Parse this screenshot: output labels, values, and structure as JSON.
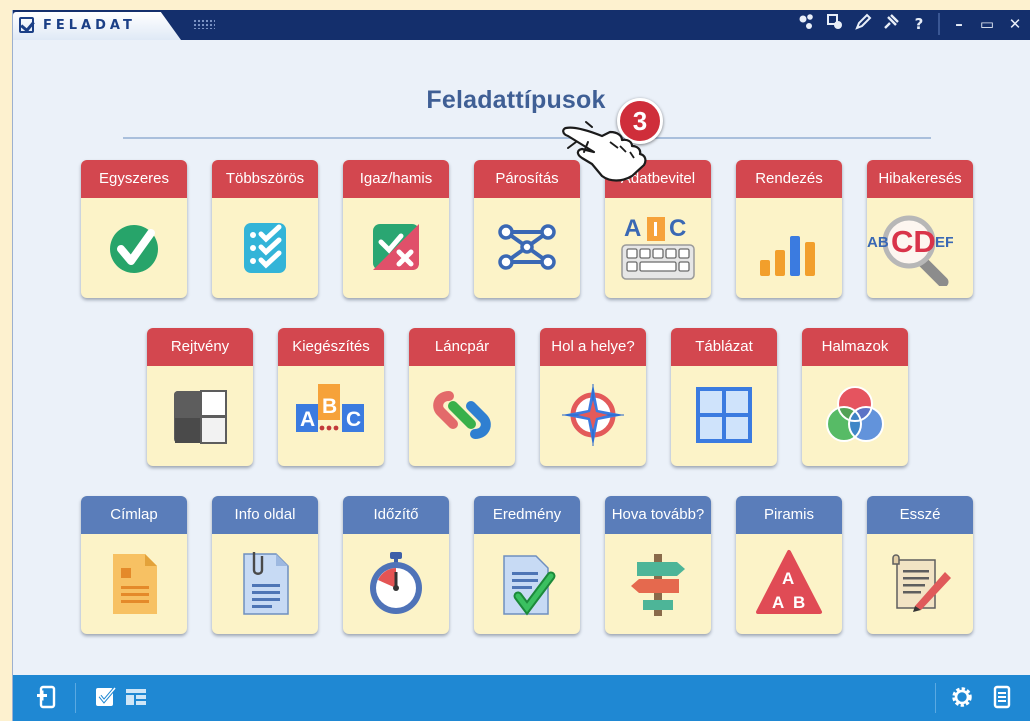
{
  "window": {
    "title": "FELADAT"
  },
  "titlebar_icons": [
    "share-icon",
    "people-swap-icon",
    "pencil-icon",
    "pin-icon",
    "help-icon",
    "minimize-icon",
    "maximize-icon",
    "close-icon"
  ],
  "titlebar_glyphs": [
    "",
    "",
    "",
    "",
    "?",
    "–",
    "▭",
    "✕"
  ],
  "heading": "Feladattípusok",
  "badge": {
    "step": "3"
  },
  "rows": [
    [
      {
        "label": "Egyszeres",
        "icon": "single-choice-check-icon",
        "color": "red"
      },
      {
        "label": "Többszörös",
        "icon": "multiple-choice-checklist-icon",
        "color": "red"
      },
      {
        "label": "Igaz/hamis",
        "icon": "true-false-icon",
        "color": "red"
      },
      {
        "label": "Párosítás",
        "icon": "matching-network-icon",
        "color": "red"
      },
      {
        "label": "Adatbevitel",
        "icon": "keyboard-abc-icon",
        "color": "red"
      },
      {
        "label": "Rendezés",
        "icon": "bar-sorting-icon",
        "color": "red"
      },
      {
        "label": "Hibakeresés",
        "icon": "magnifier-abcdef-icon",
        "color": "red"
      }
    ],
    [
      {
        "label": "Rejtvény",
        "icon": "puzzle-grid-icon",
        "color": "red"
      },
      {
        "label": "Kiegészítés",
        "icon": "abc-blocks-icon",
        "color": "red"
      },
      {
        "label": "Láncpár",
        "icon": "chain-link-icon",
        "color": "red"
      },
      {
        "label": "Hol a helye?",
        "icon": "compass-rose-icon",
        "color": "red"
      },
      {
        "label": "Táblázat",
        "icon": "table-grid-icon",
        "color": "red"
      },
      {
        "label": "Halmazok",
        "icon": "venn-diagram-icon",
        "color": "red"
      }
    ],
    [
      {
        "label": "Címlap",
        "icon": "cover-document-icon",
        "color": "blue"
      },
      {
        "label": "Info oldal",
        "icon": "info-page-clip-icon",
        "color": "blue"
      },
      {
        "label": "Időzítő",
        "icon": "stopwatch-icon",
        "color": "blue"
      },
      {
        "label": "Eredmény",
        "icon": "result-check-icon",
        "color": "blue"
      },
      {
        "label": "Hova tovább?",
        "icon": "signpost-icon",
        "color": "blue"
      },
      {
        "label": "Piramis",
        "icon": "pyramid-abab-icon",
        "color": "blue"
      },
      {
        "label": "Esszé",
        "icon": "scroll-quill-icon",
        "color": "blue"
      }
    ]
  ],
  "icon_text": {
    "keyboard": [
      "A",
      "C"
    ],
    "magnifier": [
      "AB",
      "CD",
      "EF"
    ],
    "blocks": [
      "A",
      "B",
      "C"
    ],
    "pyramid": [
      "A",
      "A",
      "B"
    ]
  },
  "bottombar": {
    "left_icons": [
      "add-page-icon",
      "task-check-icon",
      "layout-icon"
    ],
    "right_icons": [
      "gear-icon",
      "list-icon"
    ]
  },
  "colors": {
    "red_header": "#d3474f",
    "blue_header": "#5a7dba",
    "card_body": "#fcf3c8",
    "title_bar": "#142f6c",
    "bottom_bar": "#1f88d3",
    "heading": "#3f5f95"
  }
}
